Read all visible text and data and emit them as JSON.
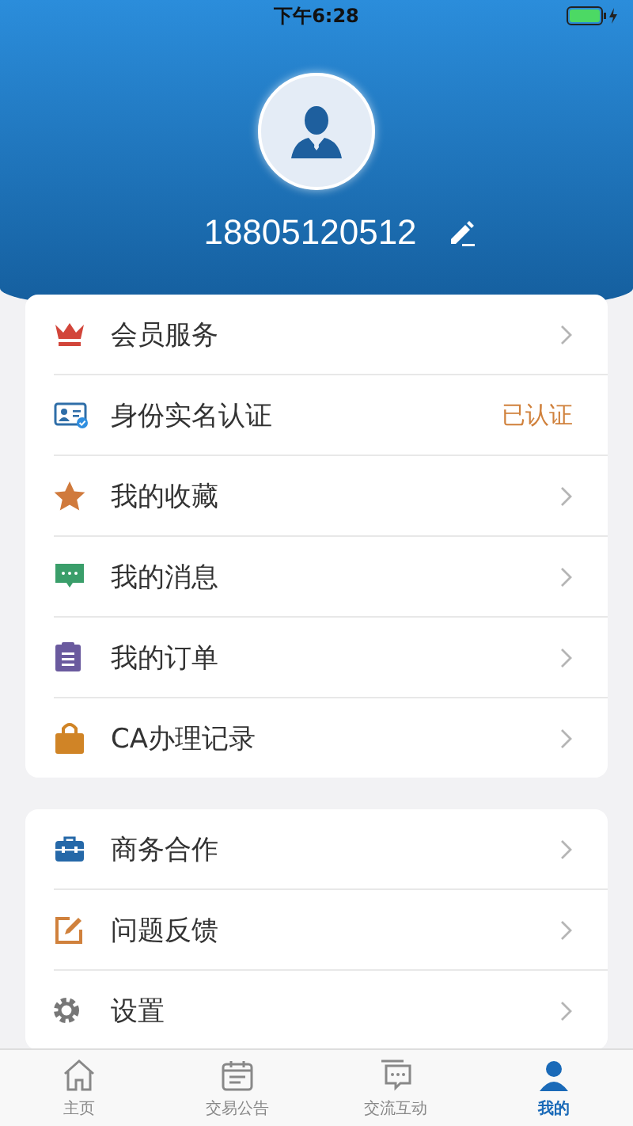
{
  "status_bar": {
    "time": "下午6:28"
  },
  "profile": {
    "phone": "18805120512"
  },
  "groups": [
    {
      "items": [
        {
          "kind": "crown",
          "label": "会员服务"
        },
        {
          "kind": "idcard",
          "label": "身份实名认证",
          "status": "已认证"
        },
        {
          "kind": "star",
          "label": "我的收藏"
        },
        {
          "kind": "message",
          "label": "我的消息"
        },
        {
          "kind": "clipboard",
          "label": "我的订单"
        },
        {
          "kind": "bag",
          "label": "CA办理记录"
        }
      ]
    },
    {
      "items": [
        {
          "kind": "briefcase",
          "label": "商务合作"
        },
        {
          "kind": "edit",
          "label": "问题反馈"
        },
        {
          "kind": "gear",
          "label": "设置"
        }
      ]
    }
  ],
  "tab_bar": [
    {
      "kind": "home",
      "label": "主页",
      "selected": false
    },
    {
      "kind": "calendar",
      "label": "交易公告",
      "selected": false
    },
    {
      "kind": "chat",
      "label": "交流互动",
      "selected": false
    },
    {
      "kind": "person",
      "label": "我的",
      "selected": true
    }
  ]
}
